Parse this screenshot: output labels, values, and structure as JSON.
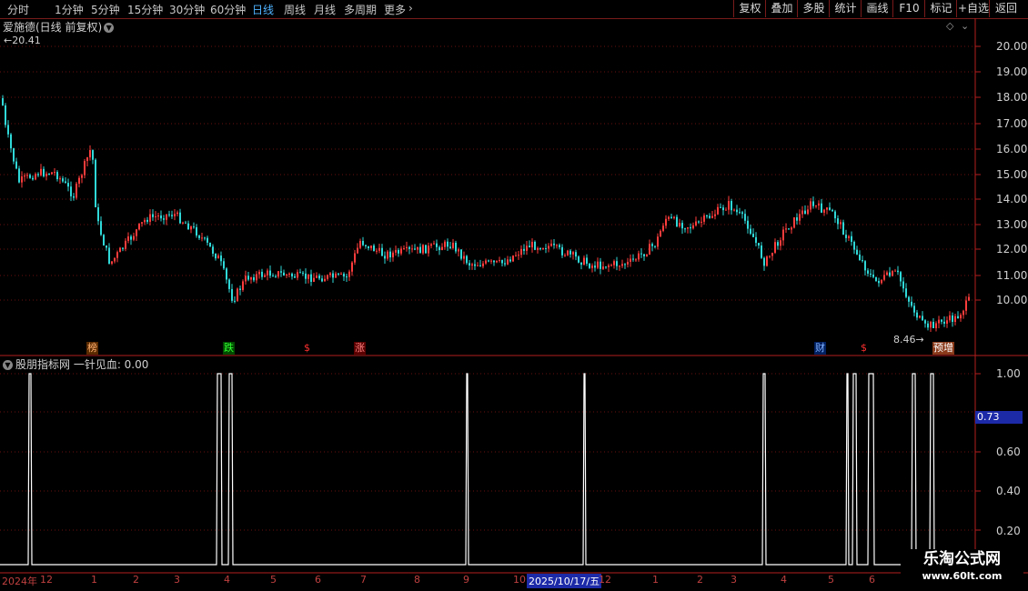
{
  "toolbar": {
    "timeframes": [
      "分时",
      "1分钟",
      "5分钟",
      "15分钟",
      "30分钟",
      "60分钟",
      "日线",
      "周线",
      "月线",
      "多周期",
      "更多"
    ],
    "active": "日线",
    "right_buttons": [
      "复权",
      "叠加",
      "多股",
      "统计",
      "画线",
      "F10",
      "标记",
      "+自选",
      "返回"
    ]
  },
  "chart": {
    "title": "爱施德(日线 前复权)",
    "high_label": "20.41",
    "low_label": "8.46",
    "price_axis": [
      "20.00",
      "19.00",
      "18.00",
      "17.00",
      "16.00",
      "15.00",
      "14.00",
      "13.00",
      "12.00",
      "11.00",
      "10.00"
    ],
    "colors": {
      "up": "#ff3c3c",
      "down": "#30d8d8",
      "grid": "#6a0f0f",
      "axis": "#b41e1e"
    }
  },
  "badges": [
    {
      "text": "榜",
      "color": "#ffb070",
      "bg": "#5a2a00",
      "day": "d1"
    },
    {
      "text": "跌",
      "color": "#30ff30",
      "bg": "#004a00",
      "day": "d2"
    },
    {
      "text": "$",
      "color": "#ff3030",
      "bg": "transparent",
      "day": "d3"
    },
    {
      "text": "涨",
      "color": "#ff8080",
      "bg": "#5a0000",
      "day": "d4"
    },
    {
      "text": "财",
      "color": "#80b0ff",
      "bg": "#002060",
      "day": "d5"
    },
    {
      "text": "$",
      "color": "#ff3030",
      "bg": "transparent",
      "day": "d6"
    },
    {
      "text": "预增",
      "color": "#ffffff",
      "bg": "#8a3a1a",
      "day": "d7"
    }
  ],
  "indicator": {
    "title": "股朋指标网  一针见血: 0.00",
    "axis": [
      "1.00",
      "0.60",
      "0.40",
      "0.20"
    ],
    "cursor_value": "0.73"
  },
  "dates": [
    "2024年",
    "12",
    "1",
    "2",
    "3",
    "4",
    "5",
    "6",
    "7",
    "8",
    "9",
    "10",
    "2025/10/17/五",
    "12",
    "1",
    "2",
    "3",
    "4",
    "5",
    "6"
  ],
  "watermark": {
    "line1": "乐淘公式网",
    "line2": "www.60lt.com"
  }
}
